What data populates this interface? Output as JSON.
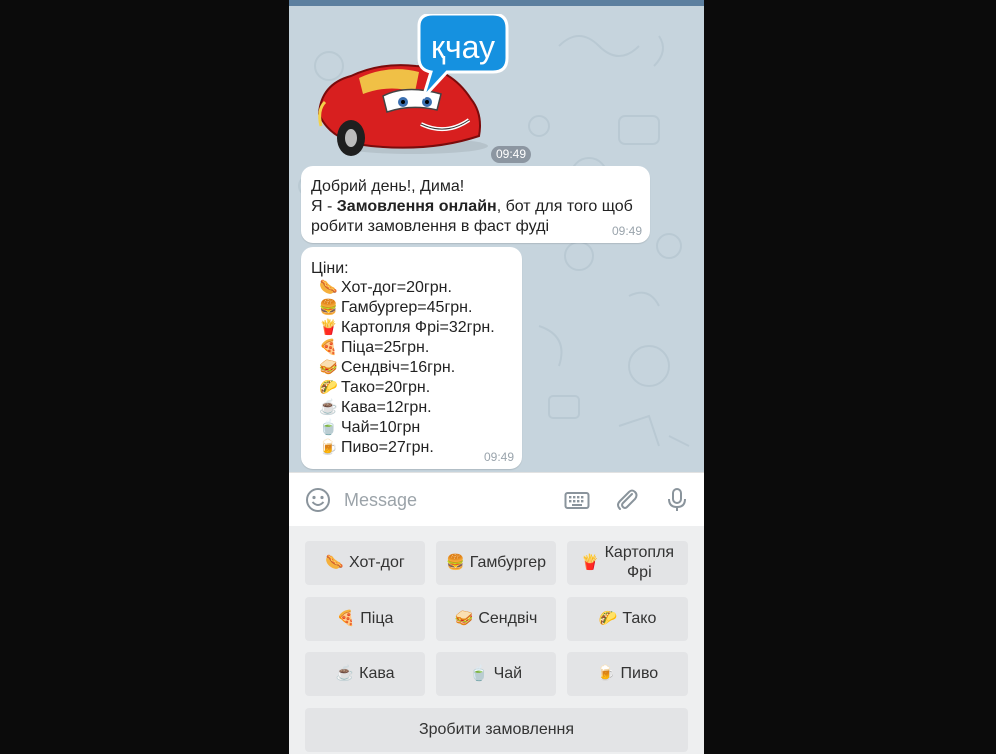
{
  "chat": {
    "sticker": {
      "text": "қчау",
      "time": "09:49"
    },
    "greeting": {
      "line1": "Добрий день!, Дима!",
      "line2_prefix": "Я - ",
      "line2_bold": "Замовлення онлайн",
      "line2_suffix": ", бот для того щоб",
      "line3": "робити замовлення в фаст фуді",
      "time": "09:49"
    },
    "prices": {
      "title": "Ціни:",
      "items": [
        {
          "emoji": "🌭",
          "text": "Хот-дог=20грн."
        },
        {
          "emoji": "🍔",
          "text": "Гамбургер=45грн."
        },
        {
          "emoji": "🍟",
          "text": "Картопля Фрі=32грн."
        },
        {
          "emoji": "🍕",
          "text": "Піца=25грн."
        },
        {
          "emoji": "🥪",
          "text": "Сендвіч=16грн."
        },
        {
          "emoji": "🌮",
          "text": "Тако=20грн."
        },
        {
          "emoji": "☕",
          "text": "Кава=12грн."
        },
        {
          "emoji": "🍵",
          "text": "Чай=10грн"
        },
        {
          "emoji": "🍺",
          "text": "Пиво=27грн."
        }
      ],
      "time": "09:49"
    }
  },
  "input": {
    "placeholder": "Message",
    "icons": [
      "emoji-icon",
      "keyboard-icon",
      "attach-icon",
      "microphone-icon"
    ]
  },
  "keyboard": {
    "buttons": [
      {
        "emoji": "🌭",
        "label": "Хот-дог"
      },
      {
        "emoji": "🍔",
        "label": "Гамбургер"
      },
      {
        "emoji": "🍟",
        "label": "Картопля\nФрі"
      },
      {
        "emoji": "🍕",
        "label": "Піца"
      },
      {
        "emoji": "🥪",
        "label": "Сендвіч"
      },
      {
        "emoji": "🌮",
        "label": "Тако"
      },
      {
        "emoji": "☕",
        "label": "Кава"
      },
      {
        "emoji": "🍵",
        "label": "Чай"
      },
      {
        "emoji": "🍺",
        "label": "Пиво"
      }
    ],
    "order_button": "Зробити замовлення"
  },
  "colors": {
    "header": "#5c7f9f",
    "chat_background": "#c6d4dd",
    "bubble": "#ffffff",
    "keyboard_button": "#e3e4e6",
    "sticker_speech_bubble": "#1591e0",
    "sticker_car": "#d81f1f"
  }
}
